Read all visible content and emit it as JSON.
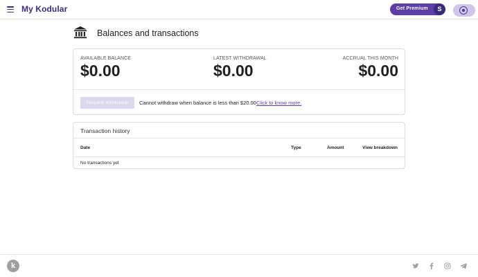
{
  "header": {
    "app_title": "My Kodular",
    "premium_label": "Get Premium",
    "avatar_initial": "S"
  },
  "page": {
    "title": "Balances and transactions"
  },
  "balances": {
    "available_label": "AVAILABLE BALANCE",
    "available_value": "$0.00",
    "withdrawal_label": "LATEST WITHDRAWAL",
    "withdrawal_value": "$0.00",
    "accrual_label": "ACCRUAL THIS MONTH",
    "accrual_value": "$0.00",
    "withdraw_button": "Request withdrawal",
    "withdraw_message": "Cannot withdraw when balance is less than $20.00",
    "know_more_link": "Click to know more."
  },
  "transactions": {
    "title": "Transaction history",
    "columns": {
      "date": "Date",
      "type": "Type",
      "amount": "Amount",
      "breakdown": "View breakdown"
    },
    "empty_message": "No transactions yet"
  },
  "footer": {
    "logo_letter": "k",
    "social_icons": [
      "twitter-icon",
      "facebook-icon",
      "instagram-icon",
      "telegram-icon"
    ]
  },
  "colors": {
    "brand": "#3d2a85",
    "accent": "#5b3ea6",
    "disabled_button": "#dcd6ef",
    "toggle": "#cfc6ea"
  }
}
